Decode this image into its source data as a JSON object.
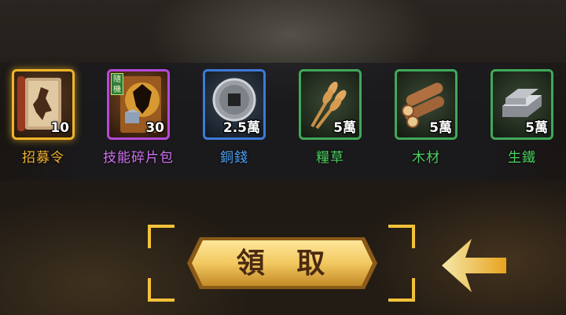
{
  "rewards": [
    {
      "name": "招募令",
      "quantity": "10",
      "rarity": "gold",
      "icon": "recruit-scroll-icon",
      "label_color": "#f0b030"
    },
    {
      "name": "技能碎片包",
      "quantity": "30",
      "rarity": "purple",
      "icon": "skill-fragment-pack-icon",
      "tag": "隨機",
      "label_color": "#d070f0"
    },
    {
      "name": "銅錢",
      "quantity": "2.5萬",
      "rarity": "blue",
      "icon": "copper-coin-icon",
      "label_color": "#4aa0f0"
    },
    {
      "name": "糧草",
      "quantity": "5萬",
      "rarity": "green",
      "icon": "wheat-icon",
      "label_color": "#4ad060"
    },
    {
      "name": "木材",
      "quantity": "5萬",
      "rarity": "green",
      "icon": "wood-logs-icon",
      "label_color": "#4ad060"
    },
    {
      "name": "生鐵",
      "quantity": "5萬",
      "rarity": "green",
      "icon": "iron-ingot-icon",
      "label_color": "#4ad060"
    }
  ],
  "claim_button": {
    "label": "領 取"
  },
  "colors": {
    "accent_gold": "#f0b428",
    "button_fill": "#f2c860"
  }
}
